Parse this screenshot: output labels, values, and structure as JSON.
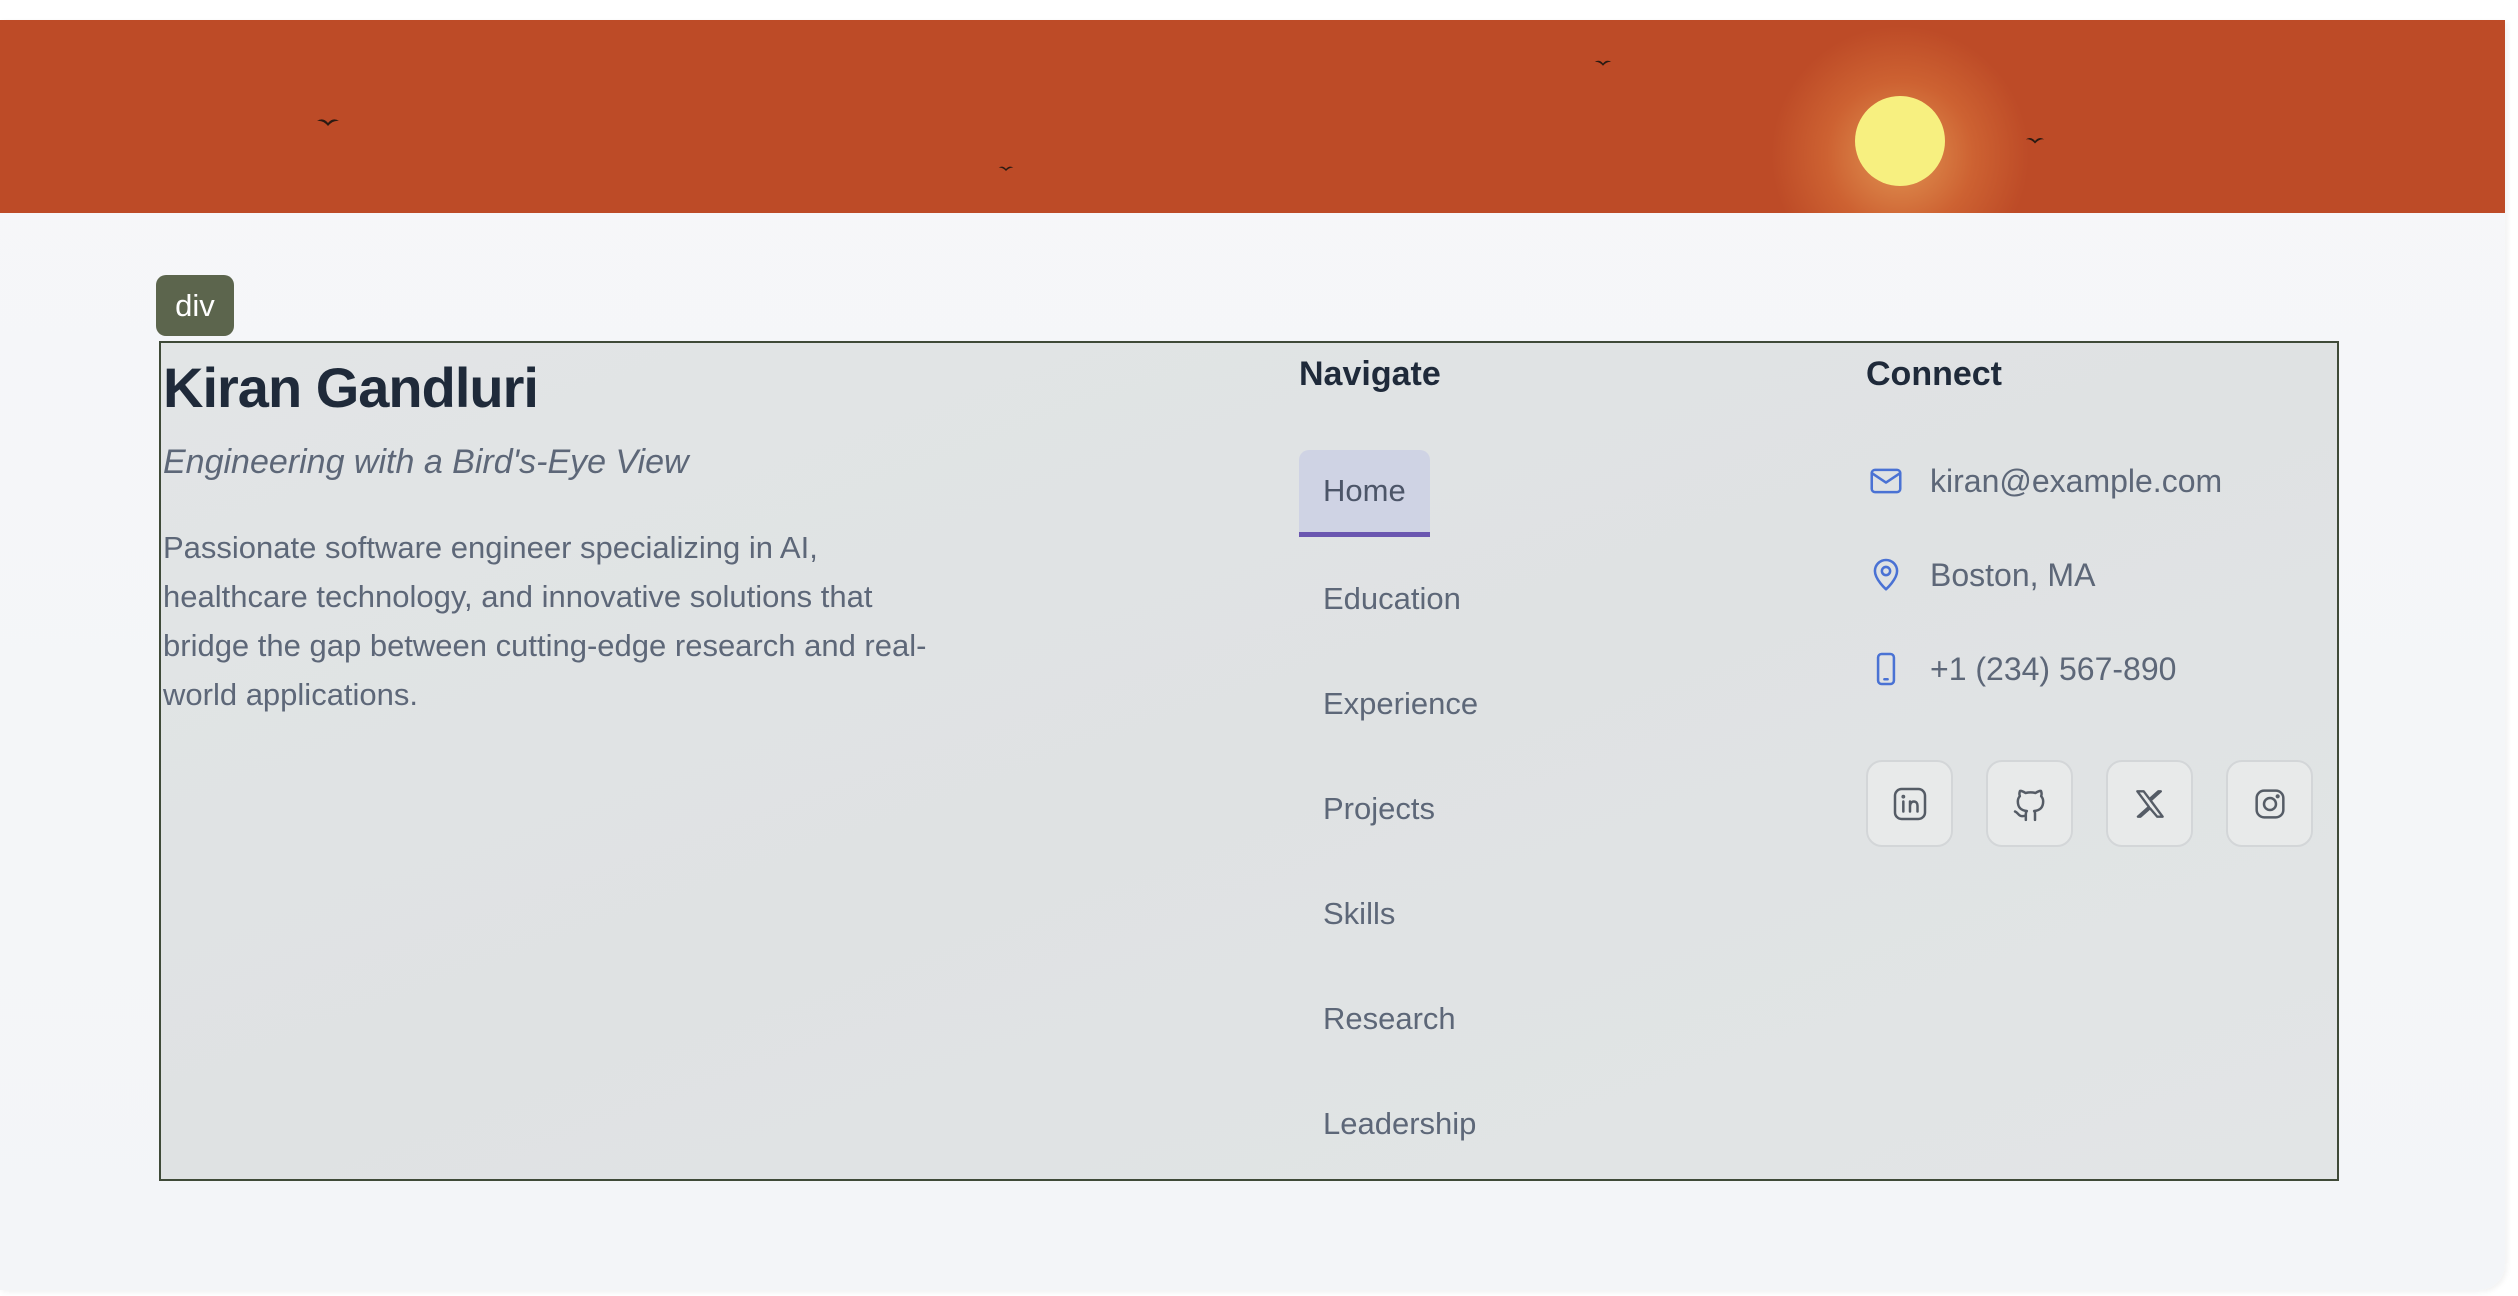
{
  "tag": {
    "label": "div"
  },
  "profile": {
    "name": "Kiran Gandluri",
    "tagline": "Engineering with a Bird's-Eye View",
    "bio": "Passionate software engineer specializing in AI, healthcare technology, and innovative solutions that bridge the gap between cutting-edge research and real-world applications."
  },
  "navigate": {
    "title": "Navigate",
    "items": [
      {
        "label": "Home",
        "active": true
      },
      {
        "label": "Education"
      },
      {
        "label": "Experience"
      },
      {
        "label": "Projects"
      },
      {
        "label": "Skills"
      },
      {
        "label": "Research"
      },
      {
        "label": "Leadership"
      }
    ]
  },
  "connect": {
    "title": "Connect",
    "email": "kiran@example.com",
    "location": "Boston, MA",
    "phone": "+1 (234) 567-890",
    "icons": [
      "mail-icon",
      "map-pin-icon",
      "phone-icon"
    ],
    "socials": [
      "linkedin-icon",
      "github-icon",
      "x-icon",
      "instagram-icon"
    ]
  },
  "colors": {
    "banner": "#bd4b27",
    "sun": "#f7f080",
    "accent": "#6a56b0",
    "icon_blue": "#4a72d4"
  }
}
